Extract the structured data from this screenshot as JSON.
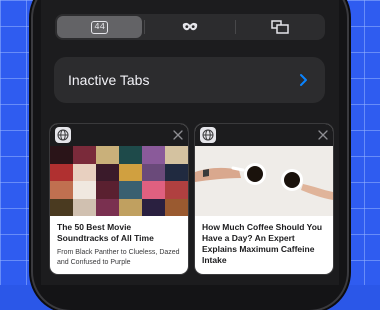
{
  "segments": [
    {
      "name": "tabs-count",
      "label": "44",
      "active": true
    },
    {
      "name": "private-mode",
      "icon": "mask-icon",
      "active": false
    },
    {
      "name": "tab-groups",
      "icon": "tab-groups-icon",
      "active": false
    }
  ],
  "inactive_tabs": {
    "label": "Inactive Tabs"
  },
  "cards": [
    {
      "title": "The 50 Best Movie Soundtracks of All Time",
      "subtitle": "From Black Panther to Clueless, Dazed and Confused to Purple"
    },
    {
      "title": "How Much Coffee Should You Have a Day? An Expert Explains Maximum Caffeine Intake",
      "subtitle": ""
    }
  ],
  "colors": {
    "accent": "#0a84ff",
    "background": "#1c1c1e"
  }
}
